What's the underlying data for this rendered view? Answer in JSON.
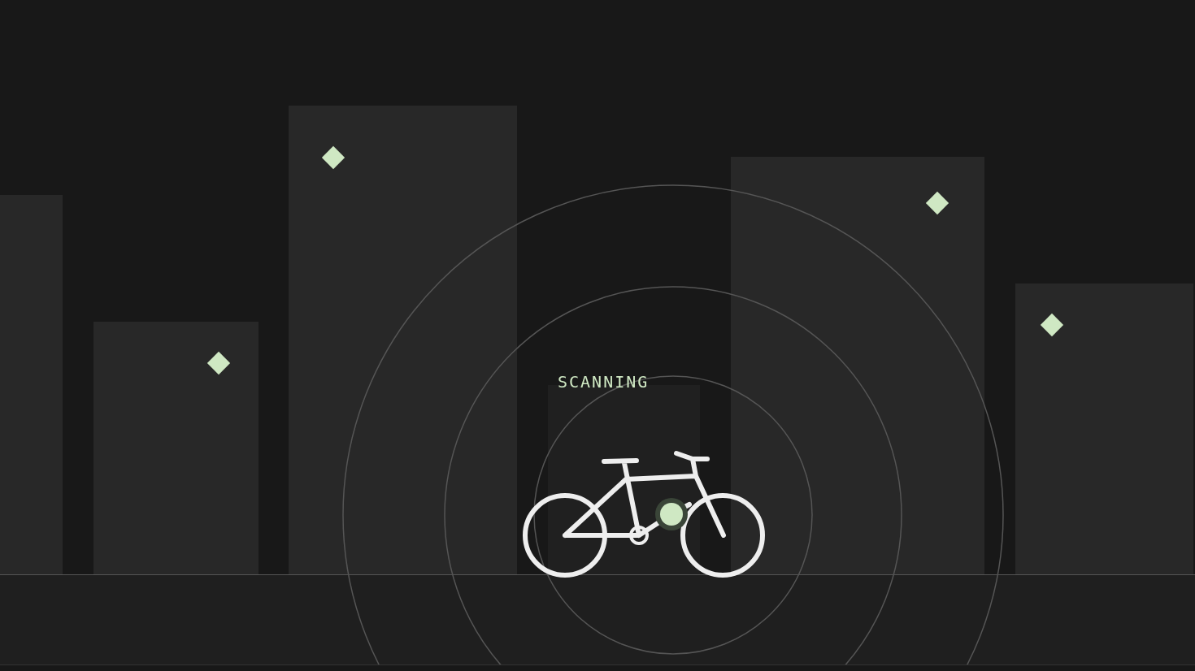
{
  "status": {
    "label": "SCANNING"
  }
}
